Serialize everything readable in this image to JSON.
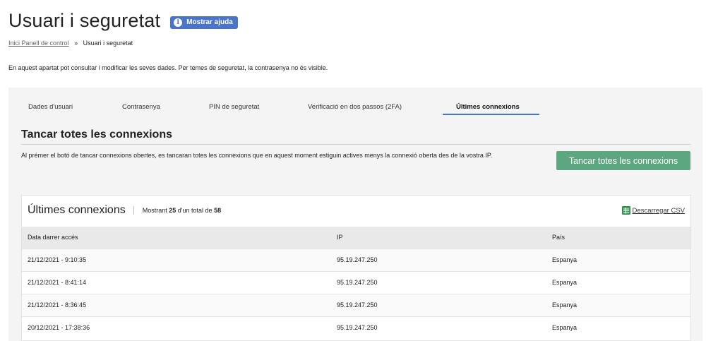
{
  "page": {
    "title": "Usuari i seguretat",
    "help_label": "Mostrar ajuda",
    "breadcrumb": {
      "home": "Inici Panell de control",
      "separator": "»",
      "current": "Usuari i seguretat"
    },
    "intro": "En aquest apartat pot consultar i modificar les seves dades. Per temes de seguretat, la contrasenya no és visible."
  },
  "tabs": [
    {
      "label": "Dades d'usuari",
      "active": false
    },
    {
      "label": "Contrasenya",
      "active": false
    },
    {
      "label": "PIN de seguretat",
      "active": false
    },
    {
      "label": "Verificació en dos passos (2FA)",
      "active": false
    },
    {
      "label": "Últimes connexions",
      "active": true
    }
  ],
  "close_section": {
    "title": "Tancar totes les connexions",
    "description": "Al prémer el botó de tancar connexions obertes, es tancaran totes les connexions que en aquest moment estiguin actives menys la connexió oberta des de la vostra IP.",
    "button_label": "Tancar totes les connexions"
  },
  "connections": {
    "title": "Últimes connexions",
    "count_prefix": "Mostrant",
    "shown": "25",
    "count_middle": "d'un total de",
    "total": "58",
    "csv_label": "Descarregar CSV",
    "columns": [
      "Data darrer accés",
      "IP",
      "País"
    ],
    "rows": [
      [
        "21/12/2021 - 9:10:35",
        "95.19.247.250",
        "Espanya"
      ],
      [
        "21/12/2021 - 8:41:14",
        "95.19.247.250",
        "Espanya"
      ],
      [
        "21/12/2021 - 8:36:45",
        "95.19.247.250",
        "Espanya"
      ],
      [
        "20/12/2021 - 17:38:36",
        "95.19.247.250",
        "Espanya"
      ]
    ]
  },
  "colors": {
    "accent": "#4a74c9",
    "action": "#5da780",
    "panel_bg": "#f4f4f4"
  }
}
